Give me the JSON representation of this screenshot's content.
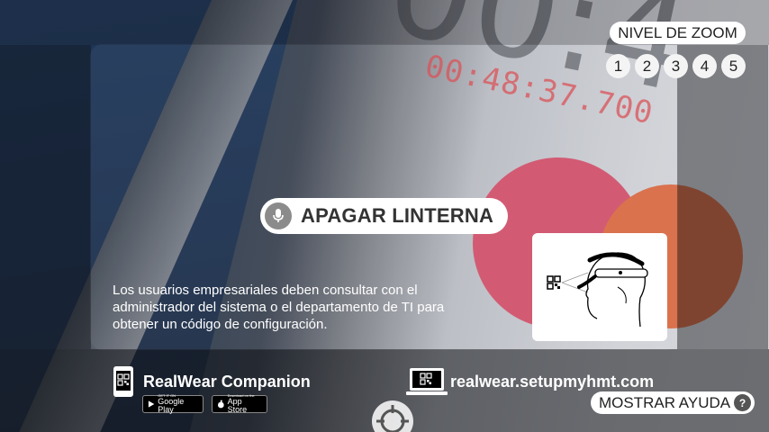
{
  "zoom": {
    "label": "NIVEL DE ZOOM",
    "levels": [
      "1",
      "2",
      "3",
      "4",
      "5"
    ]
  },
  "voice_command": {
    "icon": "microphone-icon",
    "label": "APAGAR LINTERNA"
  },
  "info": {
    "message": "Los usuarios empresariales deben consultar con el administrador del sistema o el departamento de TI para obtener un código de configuración."
  },
  "footer": {
    "companion": {
      "icon": "phone-qr-icon",
      "name": "RealWear Companion",
      "google_play_top": "GET IT ON",
      "google_play": "Google Play",
      "app_store_top": "Download on the",
      "app_store": "App Store"
    },
    "web": {
      "icon": "laptop-qr-icon",
      "url": "realwear.setupmyhmt.com"
    },
    "help": {
      "label": "MOSTRAR AYUDA",
      "icon": "?"
    }
  },
  "background": {
    "timer_text": "00:48:37.700"
  }
}
